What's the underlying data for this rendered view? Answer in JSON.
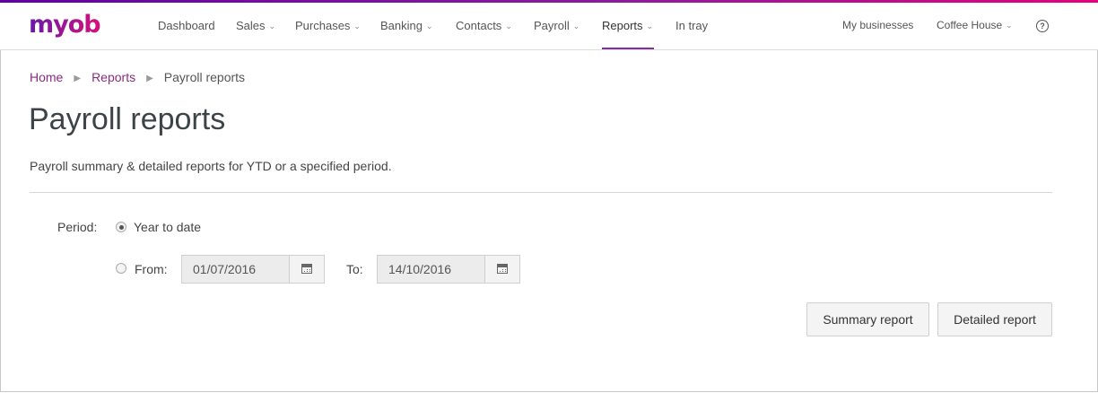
{
  "brand": {
    "logo": "myob",
    "accent": "#8b2c9e",
    "gradient_start": "#6100a5",
    "gradient_end": "#e6007e"
  },
  "nav": {
    "items": [
      {
        "label": "Dashboard",
        "dropdown": false
      },
      {
        "label": "Sales",
        "dropdown": true
      },
      {
        "label": "Purchases",
        "dropdown": true
      },
      {
        "label": "Banking",
        "dropdown": true
      },
      {
        "label": "Contacts",
        "dropdown": true
      },
      {
        "label": "Payroll",
        "dropdown": true
      },
      {
        "label": "Reports",
        "dropdown": true,
        "active": true
      },
      {
        "label": "In tray",
        "dropdown": false
      }
    ],
    "my_businesses": "My businesses",
    "business_name": "Coffee House",
    "help_icon": "help-circle-icon"
  },
  "breadcrumb": {
    "home": "Home",
    "reports": "Reports",
    "current": "Payroll reports"
  },
  "page": {
    "title": "Payroll reports",
    "subtitle": "Payroll summary & detailed reports for YTD or a specified period."
  },
  "form": {
    "period_label": "Period:",
    "ytd_label": "Year to date",
    "ytd_selected": true,
    "from_label": "From:",
    "from_value": "01/07/2016",
    "to_label": "To:",
    "to_value": "14/10/2016"
  },
  "buttons": {
    "summary": "Summary report",
    "detailed": "Detailed report"
  }
}
